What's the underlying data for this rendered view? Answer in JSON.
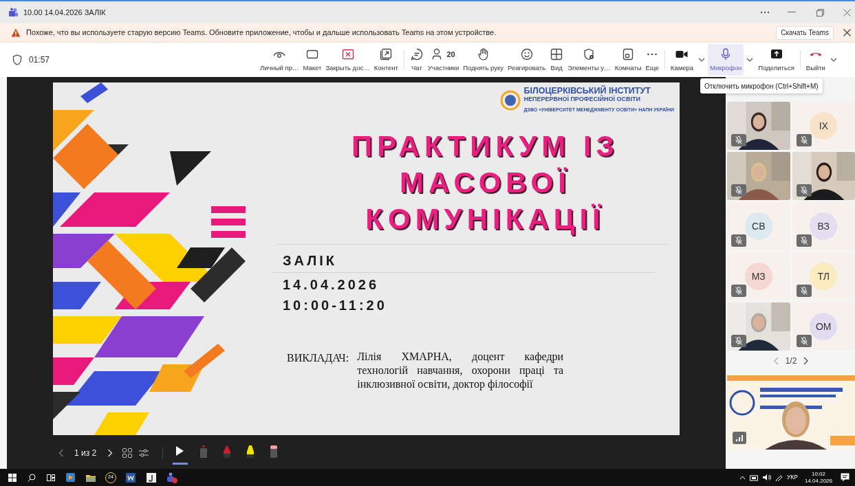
{
  "window": {
    "title": "10.00 14.04.2026 ЗАЛІК"
  },
  "banner": {
    "text": "Похоже, что вы используете старую версию Teams. Обновите приложение, чтобы и дальше использовать Teams на этом устройстве.",
    "button": "Скачать Teams"
  },
  "toolbar": {
    "timer": "01:57",
    "groups": [
      [
        {
          "label": "Личный пр…",
          "selected": false,
          "dropdown": false
        },
        {
          "label": "Макет",
          "selected": false,
          "dropdown": false
        },
        {
          "label": "Закрыть дос…",
          "selected": false,
          "dropdown": false
        },
        {
          "label": "Контент",
          "selected": false,
          "dropdown": false
        }
      ],
      [
        {
          "label": "Чат",
          "selected": false,
          "dropdown": false
        },
        {
          "label": "Участники",
          "count": "20",
          "selected": false,
          "dropdown": false
        },
        {
          "label": "Поднять руку",
          "selected": false,
          "dropdown": false
        },
        {
          "label": "Реагировать",
          "selected": false,
          "dropdown": false
        },
        {
          "label": "Вид",
          "selected": false,
          "dropdown": false
        },
        {
          "label": "Элементы у…",
          "selected": false,
          "dropdown": false
        },
        {
          "label": "Комнаты",
          "selected": false,
          "dropdown": false
        },
        {
          "label": "Еще",
          "selected": false,
          "dropdown": false
        }
      ],
      [
        {
          "label": "Камера",
          "selected": false,
          "dropdown": true
        },
        {
          "label": "Микрофон",
          "selected": true,
          "dropdown": true
        },
        {
          "label": "Поделиться",
          "selected": false,
          "dropdown": false
        }
      ],
      [
        {
          "label": "Выйти",
          "selected": false,
          "dropdown": true
        }
      ]
    ]
  },
  "tooltip": "Отключить микрофон (Ctrl+Shift+M)",
  "slide": {
    "logo": [
      "БІЛОЦЕРКІВСЬКИЙ ІНСТИТУТ",
      "НЕПЕРЕРВНОЇ ПРОФЕСІЙНОЇ ОСВІТИ",
      "ДЗВО «УНІВЕРСИТЕТ МЕНЕДЖМЕНТУ ОСВІТИ» НАПН УКРАЇНИ"
    ],
    "title_lines": [
      "ПРАКТИКУМ ІЗ",
      "МАСОВОЇ",
      "КОМУНІКАЦІЇ"
    ],
    "details": [
      "ЗАЛІК",
      "14.04.2026",
      "10:00-11:20"
    ],
    "teacher_label": "ВИКЛАДАЧ:",
    "teacher": "Лілія ХМАРНА, доцент кафедри технологій навчання, охорони праці та інклюзивної освіти, доктор філософії"
  },
  "slide_controls": {
    "page": "1 из 2",
    "tools": [
      {
        "selected": true
      },
      {
        "selected": false
      },
      {
        "selected": false
      },
      {
        "selected": false
      },
      {
        "selected": false
      }
    ]
  },
  "participants": {
    "tiles": [
      {
        "kind": "video",
        "muted": true
      },
      {
        "kind": "avatar",
        "initials": "ІХ",
        "color": "#f8e3c8",
        "muted": true
      },
      {
        "kind": "video",
        "muted": true
      },
      {
        "kind": "video",
        "muted": true
      },
      {
        "kind": "avatar",
        "initials": "СВ",
        "color": "#dce9ee",
        "muted": true
      },
      {
        "kind": "avatar",
        "initials": "ВЗ",
        "color": "#e4def0",
        "muted": true
      },
      {
        "kind": "avatar",
        "initials": "МЗ",
        "color": "#f5d8d2",
        "muted": true
      },
      {
        "kind": "avatar",
        "initials": "ТЛ",
        "color": "#fbecbf",
        "muted": true
      },
      {
        "kind": "video",
        "muted": true
      },
      {
        "kind": "avatar",
        "initials": "ОМ",
        "color": "#e1dcf0",
        "muted": true
      }
    ],
    "pagination": "1/2"
  },
  "taskbar": {
    "badge": "24",
    "language": "УКР",
    "time": "10:02",
    "date": "14.04.2026"
  }
}
